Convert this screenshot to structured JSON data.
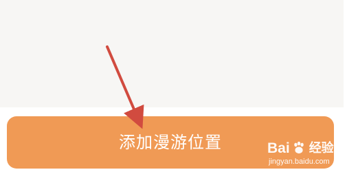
{
  "screen": {
    "background": "#f7f6f4"
  },
  "action": {
    "button_label": "添加漫游位置",
    "button_color": "#f09a55",
    "label_color": "#ffffff"
  },
  "annotation": {
    "arrow_color": "#d14b3f",
    "arrow_icon": "annotation-arrow-icon"
  },
  "watermark": {
    "brand_prefix": "Bai",
    "paw_icon": "baidu-paw-icon",
    "brand_suffix": "经验",
    "url": "jingyan.baidu.com"
  }
}
